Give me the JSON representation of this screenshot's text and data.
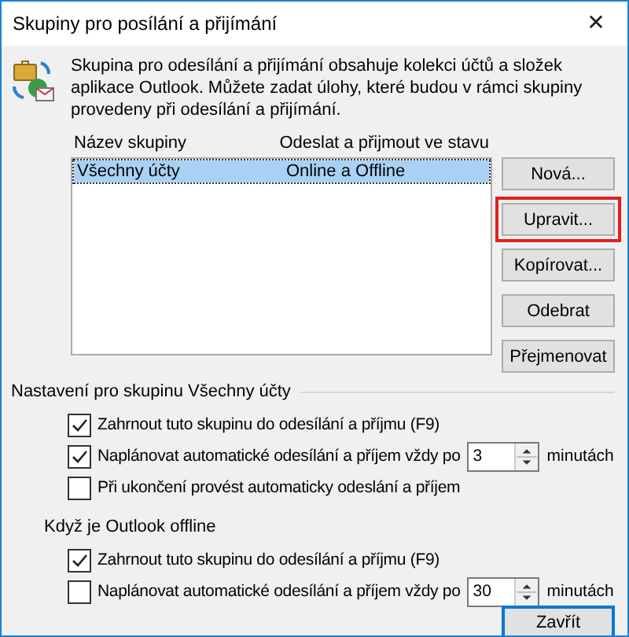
{
  "window": {
    "title": "Skupiny pro posílání a přijímání",
    "close": "✕"
  },
  "description": "Skupina pro odesílání a přijímání obsahuje kolekci účtů a složek aplikace Outlook. Můžete zadat úlohy, které budou v rámci skupiny provedeny při odesílání a přijímání.",
  "table": {
    "columns": [
      "Název skupiny",
      "Odeslat a přijmout ve stavu"
    ],
    "rows": [
      {
        "cells": [
          "Všechny účty",
          "Online a Offline"
        ],
        "selected": true
      }
    ]
  },
  "buttons": [
    {
      "label": "Nová...",
      "highlighted": false
    },
    {
      "label": "Upravit...",
      "highlighted": true
    },
    {
      "label": "Kopírovat...",
      "highlighted": false
    },
    {
      "label": "Odebrat",
      "highlighted": false
    },
    {
      "label": "Přejmenovat",
      "highlighted": false
    }
  ],
  "settings_group": {
    "title": "Nastavení pro skupinu Všechny účty",
    "options": [
      {
        "kind": "checkbox",
        "label": "Zahrnout tuto skupinu do odesílání a příjmu (F9)",
        "checked": true
      },
      {
        "kind": "schedule",
        "label": "Naplánovat automatické odesílání a příjem vždy po",
        "checked": true,
        "value": "3",
        "unit": "minutách"
      },
      {
        "kind": "checkbox",
        "label": "Při ukončení provést automaticky odeslání a příjem",
        "checked": false
      }
    ]
  },
  "offline_group": {
    "title": "Když je Outlook offline",
    "options": [
      {
        "kind": "checkbox",
        "label": "Zahrnout tuto skupinu do odesílání a příjmu (F9)",
        "checked": true
      },
      {
        "kind": "schedule",
        "label": "Naplánovat automatické odesílání a příjem vždy po",
        "checked": false,
        "value": "30",
        "unit": "minutách"
      }
    ]
  },
  "close_button": "Zavřít"
}
